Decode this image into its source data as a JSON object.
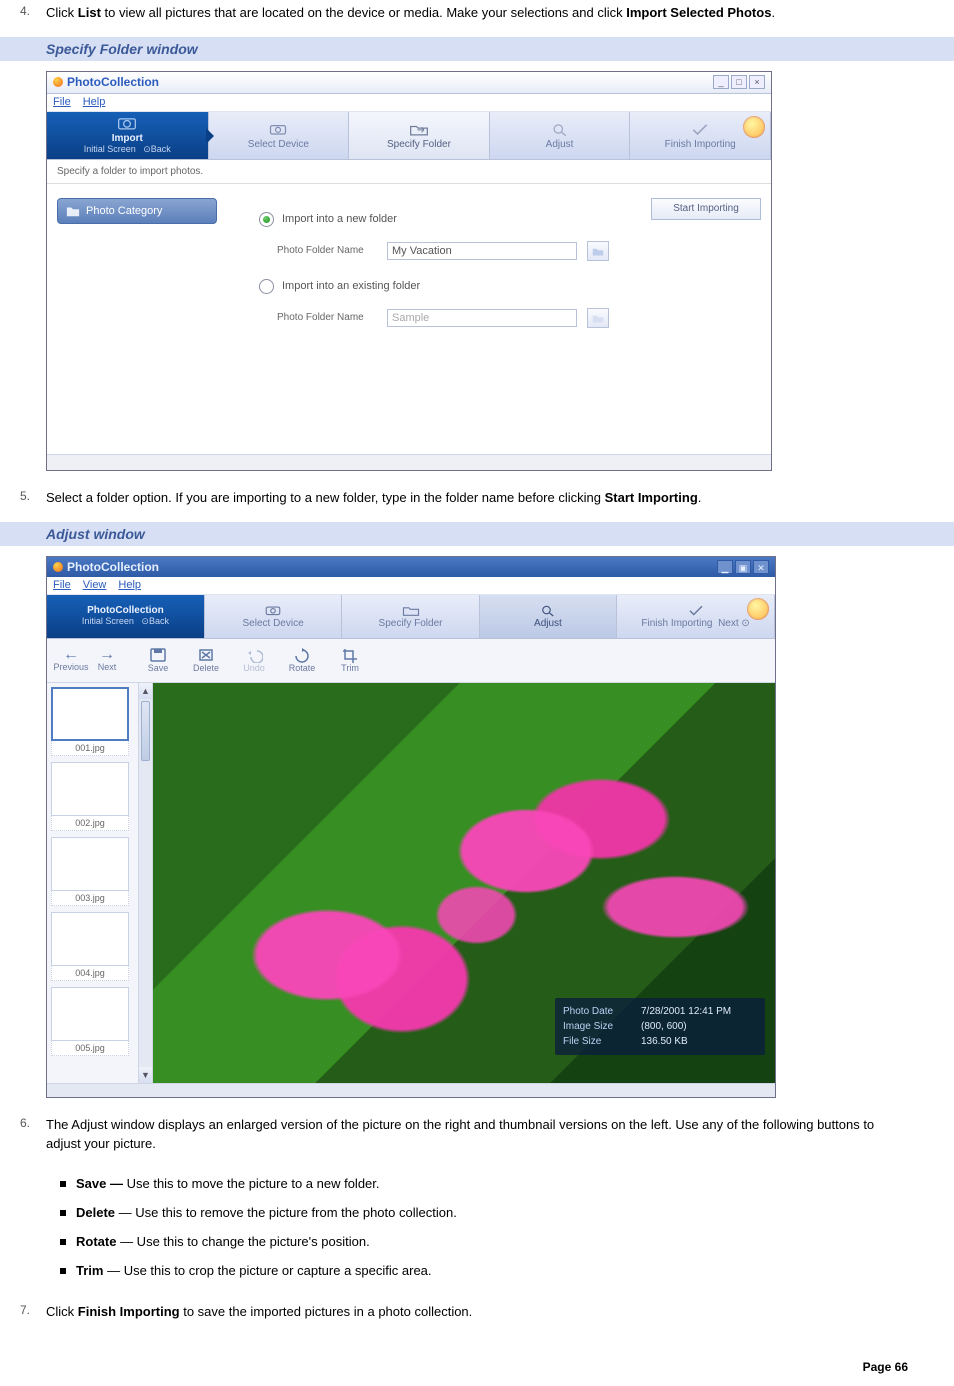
{
  "step4": {
    "num": "4.",
    "text_a": "Click ",
    "bold1": "List",
    "text_b": " to view all pictures that are located on the device or media. Make your selections and click ",
    "bold2": "Import Selected Photos",
    "text_c": "."
  },
  "section1_title": "Specify Folder window",
  "app1": {
    "title": "PhotoCollection",
    "menu": {
      "file": "File",
      "help": "Help"
    },
    "steps": {
      "import": "Import",
      "initial_screen": "Initial Screen",
      "back": "Back",
      "select_device": "Select Device",
      "specify_folder": "Specify Folder",
      "adjust": "Adjust",
      "finish_importing": "Finish Importing"
    },
    "hint": "Specify a folder to import photos.",
    "sidebar": {
      "photo_category": "Photo Category"
    },
    "form": {
      "opt_new": "Import into a new folder",
      "opt_existing": "Import into an existing folder",
      "label": "Photo Folder Name",
      "new_value": "My Vacation",
      "existing_placeholder": "Sample"
    },
    "start_importing": "Start Importing"
  },
  "step5": {
    "num": "5.",
    "text_a": "Select a folder option. If you are importing to a new folder, type in the folder name before clicking ",
    "bold1": "Start Importing",
    "text_b": "."
  },
  "section2_title": "Adjust window",
  "app2": {
    "title": "PhotoCollection",
    "menu": {
      "file": "File",
      "view": "View",
      "help": "Help"
    },
    "steps": {
      "brand": "PhotoCollection",
      "initial_screen": "Initial Screen",
      "back": "Back",
      "select_device": "Select Device",
      "specify_folder": "Specify Folder",
      "adjust": "Adjust",
      "finish_importing": "Finish Importing",
      "next": "Next"
    },
    "nav": {
      "previous": "Previous",
      "next": "Next"
    },
    "actions": {
      "save": "Save",
      "delete": "Delete",
      "undo": "Undo",
      "rotate": "Rotate",
      "trim": "Trim"
    },
    "thumbs": [
      "001.jpg",
      "002.jpg",
      "003.jpg",
      "004.jpg",
      "005.jpg"
    ],
    "info": {
      "k_date": "Photo Date",
      "v_date": "7/28/2001 12:41 PM",
      "k_size": "Image Size",
      "v_size": "(800, 600)",
      "k_file": "File Size",
      "v_file": "136.50 KB"
    }
  },
  "step6": {
    "num": "6.",
    "text": "The Adjust window displays an enlarged version of the picture on the right and thumbnail versions on the left. Use any of the following buttons to adjust your picture."
  },
  "bullets": {
    "save": {
      "b": "Save —",
      "t": " Use this to move the picture to a new folder."
    },
    "delete": {
      "b": "Delete",
      "t": " — Use this to remove the picture from the photo collection."
    },
    "rotate": {
      "b": "Rotate",
      "t": " — Use this to change the picture's position."
    },
    "trim": {
      "b": "Trim",
      "t": " — Use this to crop the picture or capture a specific area."
    }
  },
  "step7": {
    "num": "7.",
    "text_a": "Click ",
    "bold1": "Finish Importing",
    "text_b": " to save the imported pictures in a photo collection."
  },
  "page_num_label": "Page ",
  "page_num": "66"
}
